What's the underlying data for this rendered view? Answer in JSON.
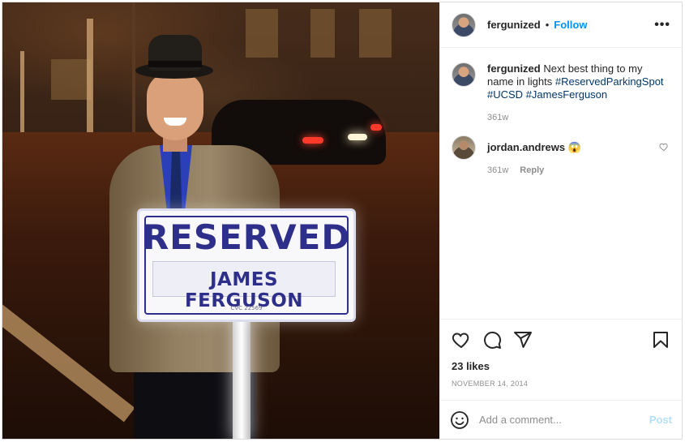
{
  "post": {
    "author": "fergunized",
    "follow_label": "Follow",
    "separator": "•",
    "more_label": "•••",
    "image": {
      "sign_top_text": "RESERVED",
      "sign_name_text": "JAMES FERGUSON",
      "sign_code_text": "CVC 22569"
    },
    "caption": {
      "author": "fergunized",
      "text": "Next best thing to my name in lights",
      "hashtags": [
        "#ReservedParkingSpot",
        "#UCSD",
        "#JamesFerguson"
      ],
      "time": "361w"
    },
    "comments": [
      {
        "author": "jordan.andrews",
        "text": "😱",
        "time": "361w",
        "reply_label": "Reply"
      }
    ],
    "likes": "23 likes",
    "date": "NOVEMBER 14, 2014",
    "comment_input": {
      "placeholder": "Add a comment...",
      "post_label": "Post"
    }
  },
  "icons": {
    "like": "heart-icon",
    "comment": "comment-bubble-icon",
    "share": "paper-plane-icon",
    "save": "bookmark-icon",
    "emoji": "smiley-icon"
  },
  "colors": {
    "link_blue": "#0095f6",
    "hashtag": "#00376b",
    "muted": "#8e8e8e",
    "post_disabled": "#b2dffc",
    "sign_blue": "#2e2f8a"
  }
}
